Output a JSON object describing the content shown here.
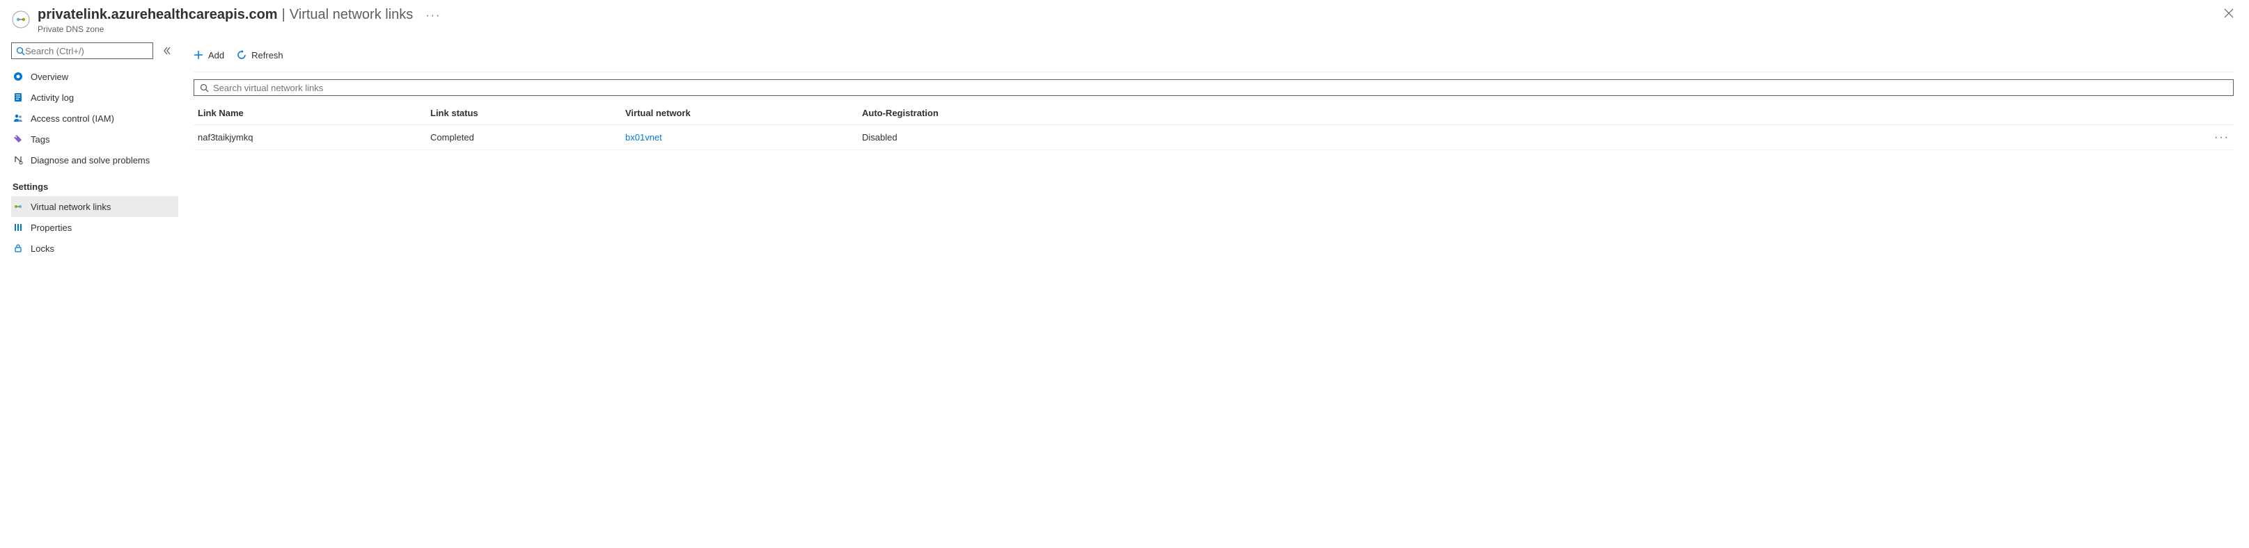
{
  "header": {
    "title_strong": "privatelink.azurehealthcareapis.com",
    "title_light": "Virtual network links",
    "subtitle": "Private DNS zone"
  },
  "sidebar": {
    "search_placeholder": "Search (Ctrl+/)",
    "items_top": [
      {
        "label": "Overview"
      },
      {
        "label": "Activity log"
      },
      {
        "label": "Access control (IAM)"
      },
      {
        "label": "Tags"
      },
      {
        "label": "Diagnose and solve problems"
      }
    ],
    "group_settings_label": "Settings",
    "items_settings": [
      {
        "label": "Virtual network links"
      },
      {
        "label": "Properties"
      },
      {
        "label": "Locks"
      }
    ]
  },
  "toolbar": {
    "add_label": "Add",
    "refresh_label": "Refresh"
  },
  "main": {
    "search_placeholder": "Search virtual network links",
    "columns": {
      "name": "Link Name",
      "status": "Link status",
      "vnet": "Virtual network",
      "auto": "Auto-Registration"
    },
    "rows": [
      {
        "name": "naf3taikjymkq",
        "status": "Completed",
        "vnet": "bx01vnet",
        "auto": "Disabled"
      }
    ]
  }
}
